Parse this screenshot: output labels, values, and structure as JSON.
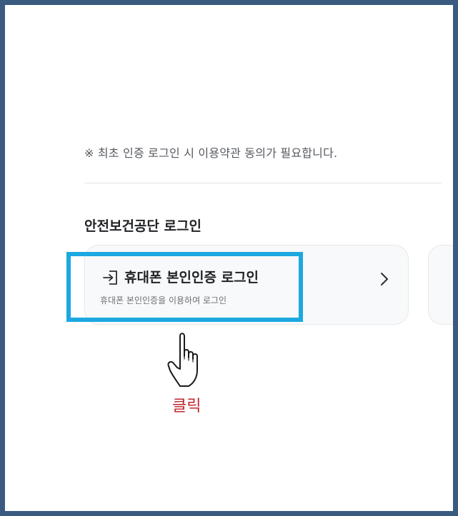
{
  "notice": "※ 최초 인증 로그인 시 이용약관 동의가 필요합니다.",
  "section_title": "안전보건공단 로그인",
  "login_card": {
    "title": "휴대폰 본인인증 로그인",
    "subtitle": "휴대폰 본인인증을 이용하여 로그인",
    "icon": "login-arrow-icon",
    "chevron": "chevron-right-icon"
  },
  "annotation": {
    "label": "클릭",
    "label_color": "#c0262d",
    "highlight_color": "#1ca8e0",
    "pointer_icon": "hand-pointer-icon"
  },
  "colors": {
    "frame_border": "#3b5a80"
  }
}
